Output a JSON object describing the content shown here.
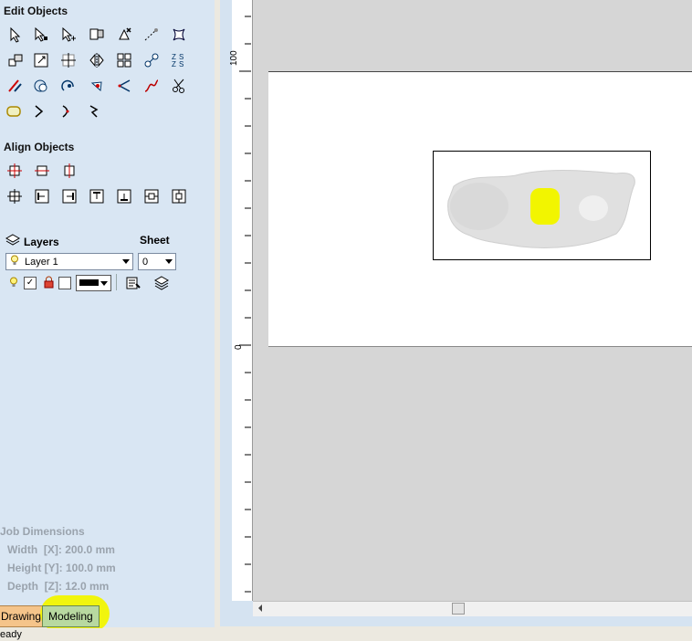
{
  "edit_objects": {
    "title": "Edit Objects",
    "tools": [
      "select-arrow-icon",
      "node-edit-icon",
      "node-add-icon",
      "transform-icon",
      "delete-icon",
      "measure-icon",
      "distort-icon",
      "move-icon",
      "scale-icon",
      "center-icon",
      "mirror-icon",
      "array-icon",
      "weld-icon",
      "nest-icon",
      "trim-icon",
      "offset-icon",
      "fillet-icon",
      "tangent-icon",
      "smooth-icon",
      "spline-icon",
      "scissors-icon",
      "boundary-icon",
      "join-open-icon",
      "join-curve-icon",
      "close-vector-icon"
    ]
  },
  "align_objects": {
    "title": "Align Objects",
    "row1": [
      "align-center-icon",
      "align-h-center-icon",
      "align-v-center-icon"
    ],
    "row2": [
      "align-all-icon",
      "align-left-icon",
      "align-right-icon",
      "align-top-icon",
      "align-bottom-icon",
      "space-h-icon",
      "space-v-icon"
    ]
  },
  "layers": {
    "title": "Layers",
    "sheet_label": "Sheet",
    "current_layer": "Layer 1",
    "current_sheet": "0"
  },
  "job_dimensions": {
    "title": "Job Dimensions",
    "width": "Width  [X]: 200.0 mm",
    "height": "Height [Y]: 100.0 mm",
    "depth": "Depth  [Z]: 12.0 mm"
  },
  "tabs": [
    "Drawing",
    "Modeling"
  ],
  "status_text": "eady",
  "ruler": {
    "label_100": "100",
    "label_0": "0"
  },
  "colors": {
    "panel_bg": "#d9e6f3",
    "highlight": "#f2f500",
    "drawing_tab": "#f5c48a"
  }
}
